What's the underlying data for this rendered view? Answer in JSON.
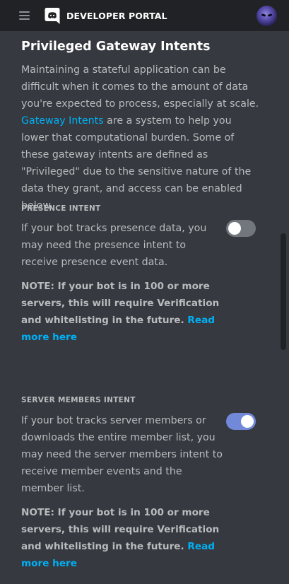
{
  "header": {
    "title": "DEVELOPER PORTAL",
    "logo_icon": "discord-logo-icon",
    "menu_icon": "hamburger-menu-icon",
    "avatar": "user-avatar"
  },
  "page": {
    "heading": "Privileged Gateway Intents",
    "intro_before": "Maintaining a stateful application can be difficult when it comes to the amount of data you're expected to process, especially at scale. ",
    "intro_link": "Gateway Intents",
    "intro_after": " are a system to help you lower that computational burden. Some of these gateway intents are defined as \"Privileged\" due to the sensitive nature of the data they grant, and access can be enabled below."
  },
  "sections": {
    "presence": {
      "title": "PRESENCE INTENT",
      "description": "If your bot tracks presence data, you may need the presence intent to receive presence event data.",
      "note": "NOTE: If your bot is in 100 or more servers, this will require Verification and whitelisting in the future. ",
      "note_link": "Read more here",
      "enabled": false
    },
    "server_members": {
      "title": "SERVER MEMBERS INTENT",
      "description": "If your bot tracks server members or downloads the entire member list, you may need the server members intent to receive member events and the member list.",
      "note": "NOTE: If your bot is in 100 or more servers, this will require Verification and whitelisting in the future. ",
      "note_link": "Read more here",
      "enabled": true
    }
  },
  "colors": {
    "background": "#36393f",
    "topbar": "#202225",
    "link": "#00b0f4",
    "toggle_on": "#7289da",
    "toggle_off": "#72767d"
  }
}
